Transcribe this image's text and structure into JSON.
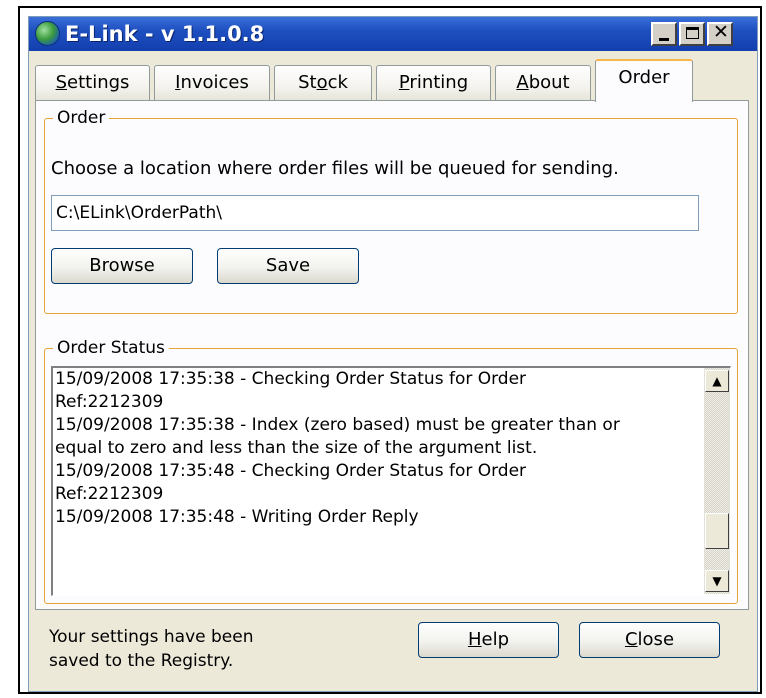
{
  "window": {
    "title": "E-Link - v 1.1.0.8",
    "title_icon": "globe-icon",
    "controls": {
      "minimize_icon": "minimize-icon",
      "maximize_icon": "maximize-icon",
      "close_icon": "close-icon",
      "close_glyph": "✕"
    }
  },
  "tabs": [
    {
      "label_pre": "",
      "mnemonic": "S",
      "label_post": "ettings",
      "active": false
    },
    {
      "label_pre": "",
      "mnemonic": "I",
      "label_post": "nvoices",
      "active": false
    },
    {
      "label_pre": "St",
      "mnemonic": "o",
      "label_post": "ck",
      "active": false
    },
    {
      "label_pre": "",
      "mnemonic": "P",
      "label_post": "rinting",
      "active": false
    },
    {
      "label_pre": "",
      "mnemonic": "A",
      "label_post": "bout",
      "active": false
    },
    {
      "label_pre": "Order",
      "mnemonic": "",
      "label_post": "",
      "active": true
    }
  ],
  "order_group": {
    "legend": "Order",
    "description": "Choose a location where order files will be queued for sending.",
    "path_value": "C:\\ELink\\OrderPath\\",
    "browse_label": "Browse",
    "save_label": "Save"
  },
  "status_group": {
    "legend": "Order Status",
    "log_lines": [
      "15/09/2008 17:35:38 - Checking Order Status for Order",
      "Ref:2212309",
      "15/09/2008 17:35:38 - Index (zero based) must be greater than or",
      "equal to zero and less than the size of the argument list.",
      "15/09/2008 17:35:48 - Checking Order Status for Order",
      "Ref:2212309",
      "15/09/2008 17:35:48 - Writing Order Reply"
    ],
    "scroll_up_glyph": "▲",
    "scroll_down_glyph": "▼",
    "scroll_position": 0.85
  },
  "footer": {
    "status_line1": "Your settings have been",
    "status_line2": "saved to the Registry.",
    "help_mnemonic": "H",
    "help_rest": "elp",
    "close_mnemonic": "C",
    "close_rest": "lose"
  },
  "colors": {
    "title_bar": "#1e4fc0",
    "group_border": "#e8a335",
    "active_tab_accent": "#f7b64a",
    "window_bg": "#ece9d8"
  }
}
